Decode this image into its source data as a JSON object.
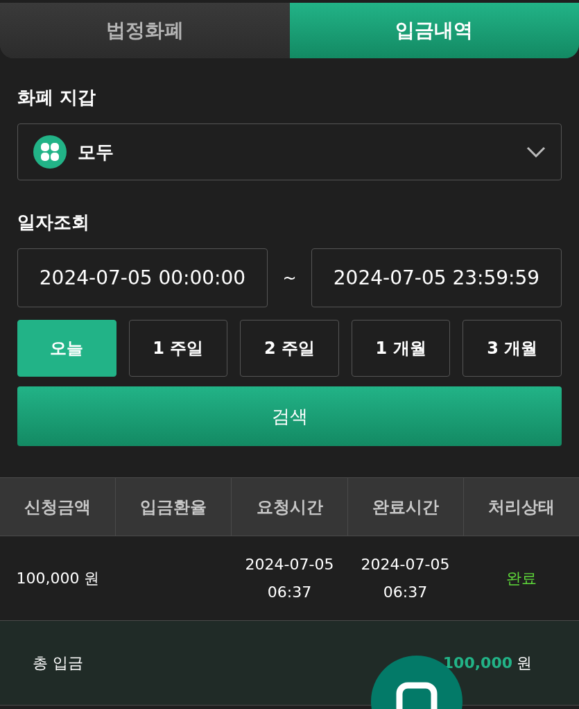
{
  "tabs": [
    {
      "label": "법정화폐",
      "selected": false
    },
    {
      "label": "입금내역",
      "selected": true
    }
  ],
  "wallet": {
    "label": "화폐 지갑",
    "value": "모두"
  },
  "date_range": {
    "label": "일자조회",
    "from": "2024-07-05 00:00:00",
    "separator": "~",
    "to": "2024-07-05 23:59:59"
  },
  "periods": [
    {
      "label": "오늘",
      "selected": true
    },
    {
      "label": "1 주일",
      "selected": false
    },
    {
      "label": "2 주일",
      "selected": false
    },
    {
      "label": "1 개월",
      "selected": false
    },
    {
      "label": "3 개월",
      "selected": false
    }
  ],
  "search_button": "검색",
  "table": {
    "columns": [
      "신청금액",
      "입금환율",
      "요청시간",
      "완료시간",
      "처리상태"
    ],
    "rows": [
      {
        "amount": "100,000 원",
        "rate": "",
        "requested": [
          "2024-07-05",
          "06:37"
        ],
        "completed": [
          "2024-07-05",
          "06:37"
        ],
        "status": "완료",
        "color": "#5fd93a"
      }
    ]
  },
  "total": {
    "label": "총 입금",
    "amount": "100,000",
    "unit": "원"
  }
}
